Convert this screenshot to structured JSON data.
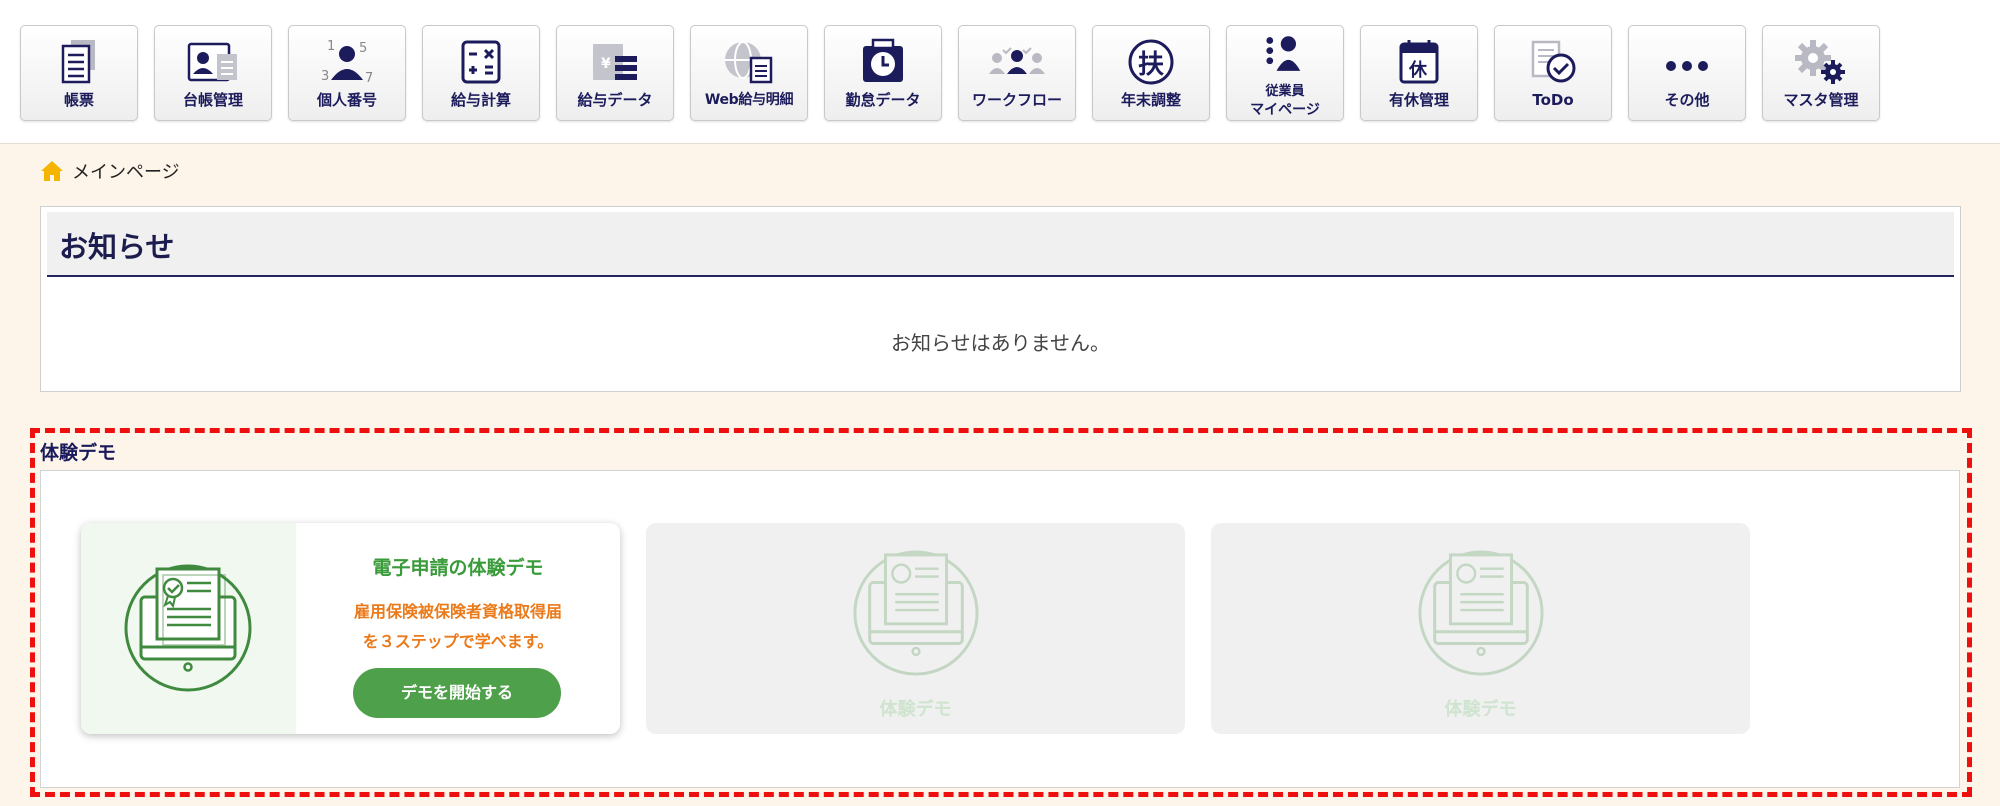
{
  "nav": [
    {
      "label": "帳票",
      "icon": "form-document-icon"
    },
    {
      "label": "台帳管理",
      "icon": "ledger-card-icon"
    },
    {
      "label": "個人番号",
      "icon": "personal-number-icon"
    },
    {
      "label": "給与計算",
      "icon": "calculator-icon"
    },
    {
      "label": "給与データ",
      "icon": "payroll-data-icon"
    },
    {
      "label": "Web給与明細",
      "icon": "web-payslip-icon"
    },
    {
      "label": "勤怠データ",
      "icon": "attendance-clock-icon"
    },
    {
      "label": "ワークフロー",
      "icon": "workflow-people-icon"
    },
    {
      "label": "年末調整",
      "icon": "year-end-adjustment-icon"
    },
    {
      "label_line1": "従業員",
      "label_line2": "マイページ",
      "icon": "employee-mypage-icon"
    },
    {
      "label": "有休管理",
      "icon": "paid-leave-calendar-icon"
    },
    {
      "label": "ToDo",
      "icon": "todo-check-icon"
    },
    {
      "label": "その他",
      "icon": "more-dots-icon"
    },
    {
      "label": "マスタ管理",
      "icon": "master-gear-icon"
    }
  ],
  "breadcrumb": {
    "label": "メインページ",
    "icon": "home-icon"
  },
  "notice": {
    "title": "お知らせ",
    "empty_message": "お知らせはありません。"
  },
  "demo": {
    "section_title": "体験デモ",
    "card": {
      "title": "電子申請の体験デモ",
      "desc_line1": "雇用保険被保険者資格取得届",
      "desc_line2": "を３ステップで学べます。",
      "button_label": "デモを開始する"
    },
    "placeholders": [
      {
        "label": "体験デモ"
      },
      {
        "label": "体験デモ"
      }
    ]
  },
  "colors": {
    "nav_text": "#1c1c5c",
    "accent_green": "#4ea04a",
    "accent_orange": "#ea7a1a",
    "frame_red": "#ee0f0f",
    "home_yellow": "#f5b400"
  }
}
